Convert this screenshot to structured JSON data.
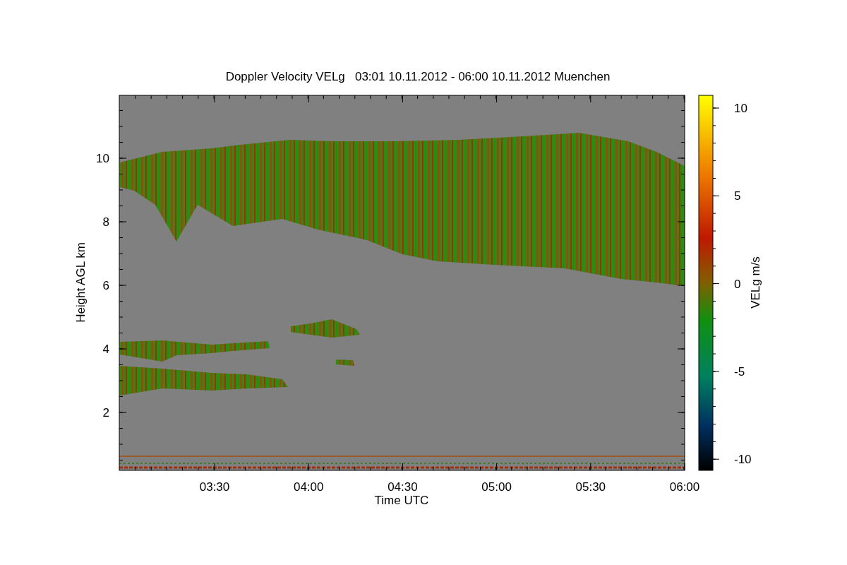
{
  "plot": {
    "title": "Doppler Velocity VELg   03:01 10.11.2012 - 06:00 10.11.2012 Muenchen",
    "xlabel": "Time UTC",
    "ylabel": "Height AGL km",
    "xticks": [
      "03:30",
      "04:00",
      "04:30",
      "05:00",
      "05:30",
      "06:00"
    ],
    "yticks": [
      "10",
      "8",
      "6",
      "4",
      "2"
    ]
  },
  "colorbar": {
    "label": "VELg m/s",
    "ticks": [
      "10",
      "5",
      "0",
      "-5",
      "-10"
    ]
  }
}
